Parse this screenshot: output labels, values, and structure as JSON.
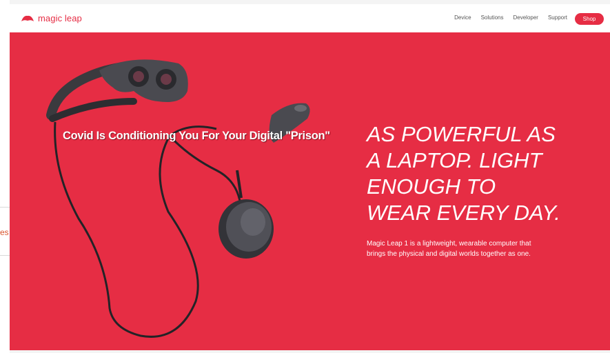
{
  "background_page": {
    "partial_text": "es"
  },
  "navbar": {
    "logo_text": "magic leap",
    "links": [
      "Device",
      "Solutions",
      "Developer",
      "Support"
    ],
    "shop_label": "Shop"
  },
  "hero": {
    "overlay_caption": "Covid Is Conditioning You For Your Digital \"Prison\"",
    "headline_lines": [
      "AS POWERFUL AS",
      "A LAPTOP. LIGHT",
      "ENOUGH TO",
      "WEAR EVERY DAY."
    ],
    "subtext_lines": [
      "Magic Leap 1 is a lightweight, wearable computer that",
      "brings the physical and digital worlds together as one."
    ]
  },
  "colors": {
    "brand": "#e62d44",
    "navbar_bg": "#ffffff",
    "text_on_brand": "#ffffff"
  },
  "icons": [
    "magic-leap-logo-icon"
  ]
}
